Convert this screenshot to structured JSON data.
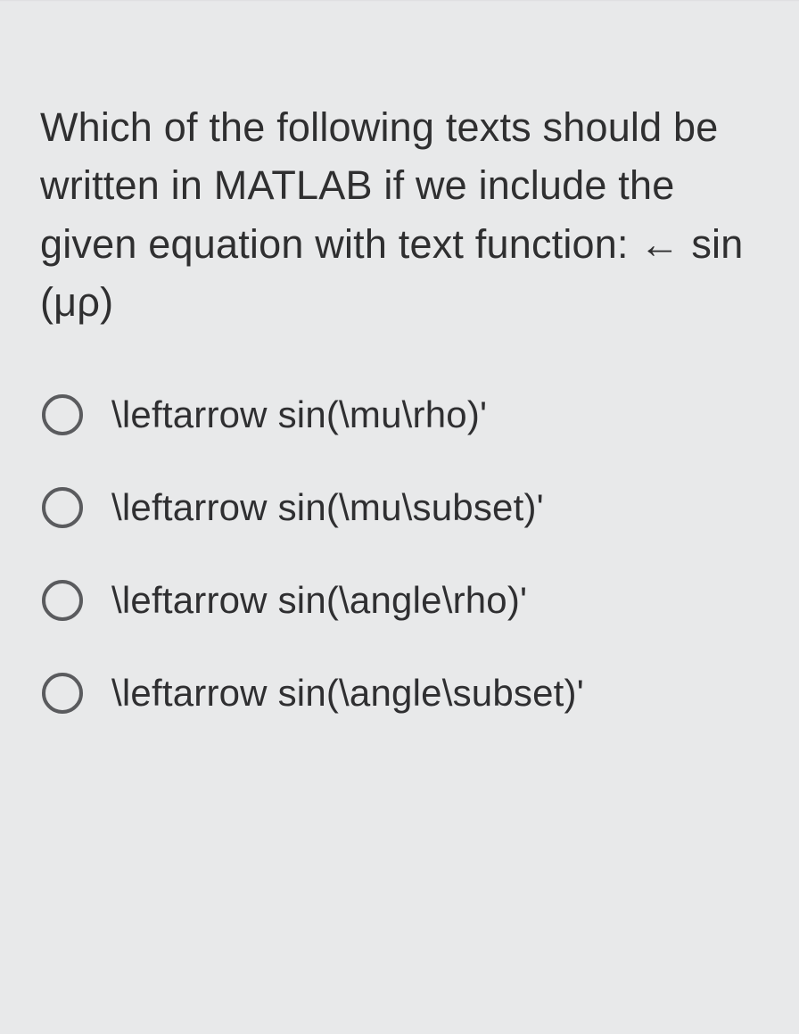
{
  "question": "Which of the following texts should be written in MATLAB if we include the given equation with text function: ← sin (μρ)",
  "options": [
    {
      "label": "\\leftarrow sin(\\mu\\rho)'"
    },
    {
      "label": "\\leftarrow sin(\\mu\\subset)'"
    },
    {
      "label": "\\leftarrow sin(\\angle\\rho)'"
    },
    {
      "label": "\\leftarrow sin(\\angle\\subset)'"
    }
  ]
}
